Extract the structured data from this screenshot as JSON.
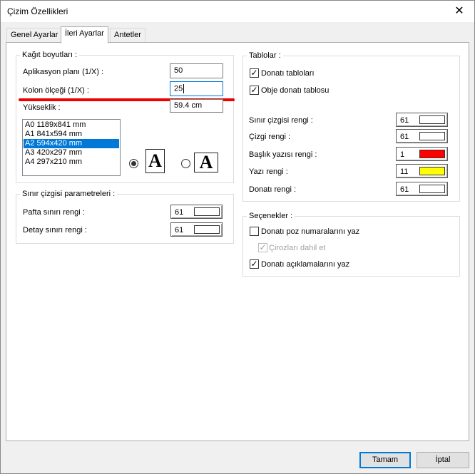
{
  "window": {
    "title": "Çizim Özellikleri",
    "close_glyph": "✕"
  },
  "tabs": [
    {
      "label": "Genel Ayarlar"
    },
    {
      "label": "İleri Ayarlar"
    },
    {
      "label": "Antetler"
    }
  ],
  "paper": {
    "group_label": "Kağıt boyutları :",
    "app_plan_label": "Aplikasyon planı (1/X) :",
    "app_plan_value": "50",
    "column_scale_label": "Kolon ölçeği (1/X) :",
    "column_scale_value": "25",
    "elevation_label": "Yükseklik :",
    "elevation_value": "59.4 cm",
    "sizes": [
      "A0 1189x841 mm",
      "A1 841x594 mm",
      "A2 594x420 mm",
      "A3 420x297 mm",
      "A4 297x210 mm"
    ],
    "selected_size": "A2 594x420 mm",
    "orientation_glyph": "A"
  },
  "border_params": {
    "group_label": "Sınır çizgisi parametreleri :",
    "sheet_border_label": "Pafta sınırı rengi :",
    "sheet_border_value": "61",
    "detail_border_label": "Detay sınırı rengi :",
    "detail_border_value": "61"
  },
  "tables": {
    "group_label": "Tablolar :",
    "rebar_tables_label": "Donatı tabloları",
    "object_rebar_table_label": "Obje donatı tablosu",
    "border_color_label": "Sınır çizgisi rengi :",
    "border_color_value": "61",
    "line_color_label": "Çizgi rengi :",
    "line_color_value": "61",
    "title_text_color_label": "Başlık yazısı rengi :",
    "title_text_color_value": "1",
    "text_color_label": "Yazı rengi :",
    "text_color_value": "11",
    "rebar_color_label": "Donatı rengi :",
    "rebar_color_value": "61"
  },
  "options": {
    "group_label": "Seçenekler :",
    "rebar_position_numbers_label": "Donatı poz numaralarını yaz",
    "include_stirrups_label": "Çirozları dahil et",
    "rebar_descriptions_label": "Donatı açıklamalarını yaz"
  },
  "buttons": {
    "ok_label": "Tamam",
    "cancel_label": "İptal"
  },
  "colors": {
    "accent": "#0078d7",
    "highlight_underline": "#e00000",
    "swatch_white": "#ffffff",
    "swatch_red": "#ff0000",
    "swatch_yellow": "#ffff00"
  },
  "icons": {
    "check": "✓",
    "close": "close-icon",
    "portrait": "portrait-page-icon",
    "landscape": "landscape-page-icon"
  }
}
